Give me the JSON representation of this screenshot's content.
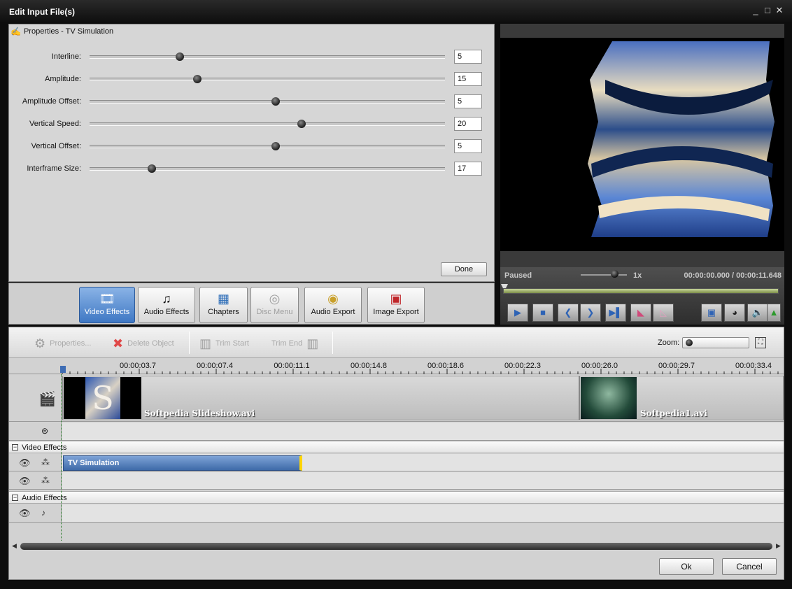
{
  "window": {
    "title": "Edit Input File(s)",
    "controls": [
      "_",
      "□",
      "✕"
    ]
  },
  "properties": {
    "heading": "Properties - TV Simulation",
    "rows": [
      {
        "label": "Interline:",
        "value": "5"
      },
      {
        "label": "Amplitude:",
        "value": "15"
      },
      {
        "label": "Amplitude Offset:",
        "value": "5"
      },
      {
        "label": "Vertical Speed:",
        "value": "20"
      },
      {
        "label": "Vertical Offset:",
        "value": "5"
      },
      {
        "label": "Interframe Size:",
        "value": "17"
      }
    ],
    "done_label": "Done"
  },
  "tabs": [
    {
      "label": "Video Effects",
      "icon": "video-effects-icon",
      "active": true
    },
    {
      "label": "Audio Effects",
      "icon": "audio-effects-icon"
    },
    {
      "label": "Chapters",
      "icon": "chapters-icon"
    },
    {
      "label": "Disc Menu",
      "icon": "disc-menu-icon",
      "disabled": true
    },
    {
      "label": "Audio Export",
      "icon": "audio-export-icon"
    },
    {
      "label": "Image Export",
      "icon": "image-export-icon"
    }
  ],
  "player": {
    "status": "Paused",
    "speed": "1x",
    "current_time": "00:00:00.000",
    "separator": "/",
    "total_time": "00:00:11.648"
  },
  "toolbar": {
    "properties": "Properties...",
    "delete": "Delete Object",
    "trim_start": "Trim Start",
    "trim_end": "Trim End",
    "zoom_label": "Zoom:"
  },
  "ruler": [
    "00:00:03.7",
    "00:00:07.4",
    "00:00:11.1",
    "00:00:14.8",
    "00:00:18.6",
    "00:00:22.3",
    "00:00:26.0",
    "00:00:29.7",
    "00:00:33.4"
  ],
  "clips": [
    {
      "name": "Softpedia Slideshow.avi"
    },
    {
      "name": "Softpedia1.avi"
    }
  ],
  "groups": {
    "video_effects": "Video Effects",
    "audio_effects": "Audio Effects"
  },
  "effect": {
    "name": "TV Simulation"
  },
  "buttons": {
    "ok": "Ok",
    "cancel": "Cancel"
  }
}
